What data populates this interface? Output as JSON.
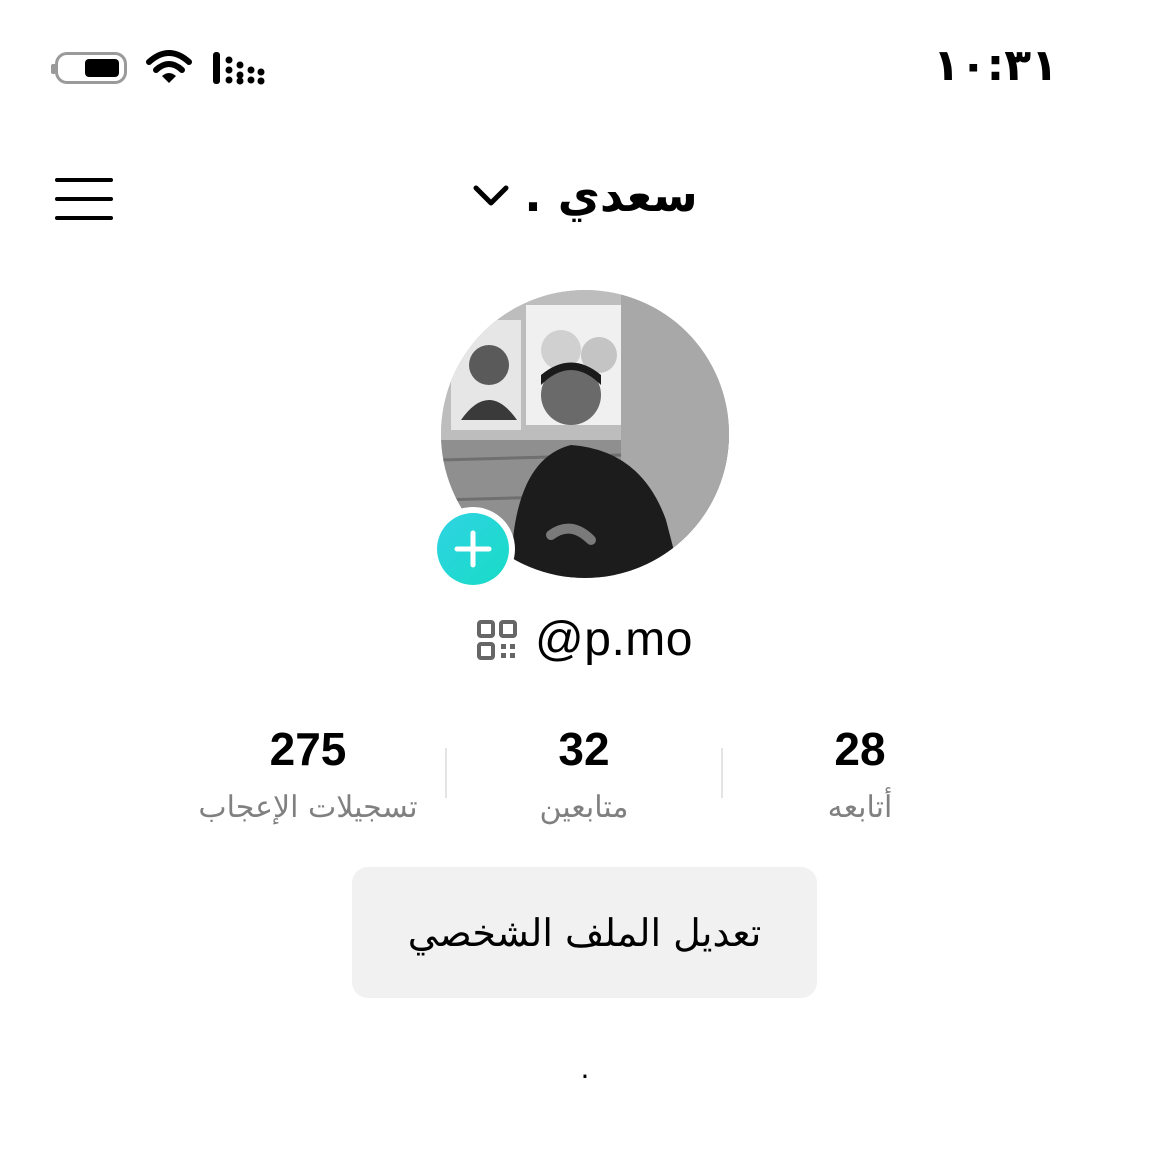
{
  "status_bar": {
    "time": "١٠:٣١",
    "battery_icon": "battery-icon",
    "wifi_icon": "wifi-icon",
    "signal_icon": "cellular-signal-icon"
  },
  "header": {
    "title": "سعدي .",
    "menu_icon": "hamburger-menu-icon",
    "dropdown_icon": "chevron-down-icon"
  },
  "profile": {
    "avatar": "profile-photo",
    "add_icon": "plus-icon",
    "qr_icon": "qr-code-icon",
    "handle": "@p.mo",
    "bio": "."
  },
  "stats": [
    {
      "value": "28",
      "label": "أتابعه"
    },
    {
      "value": "32",
      "label": "متابعين"
    },
    {
      "value": "275",
      "label": "تسجيلات الإعجاب"
    }
  ],
  "actions": {
    "edit_profile": "تعديل الملف الشخصي"
  },
  "colors": {
    "accent": "#20D5EC",
    "button_bg": "#F1F1F1",
    "label_gray": "#808080"
  }
}
